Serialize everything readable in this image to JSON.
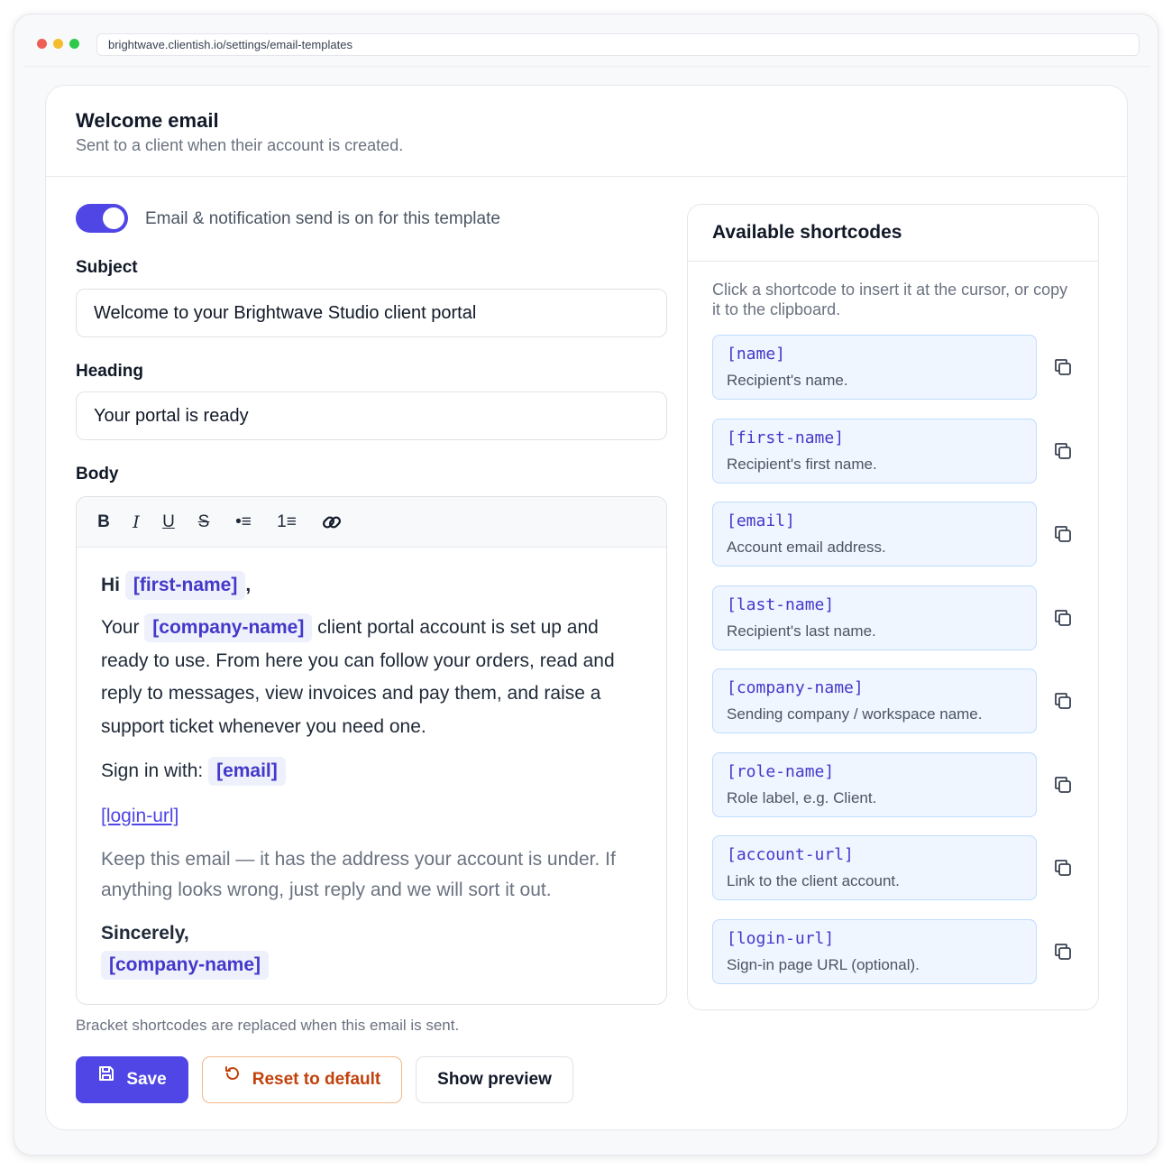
{
  "browser": {
    "url": "brightwave.clientish.io/settings/email-templates"
  },
  "template": {
    "title": "Welcome email",
    "subtitle": "Sent to a client when their account is created.",
    "toggle_label": "Email & notification send is on for this template",
    "toggle_on": true
  },
  "subject": {
    "label": "Subject",
    "value": "Welcome to your Brightwave Studio client portal"
  },
  "heading": {
    "label": "Heading",
    "value": "Your portal is ready"
  },
  "body": {
    "label": "Body",
    "toolbar": {
      "bold": "B",
      "italic": "I",
      "underline": "U",
      "strike": "S",
      "bullets": "•≡",
      "numbered": "1≡"
    },
    "greeting": "Hi",
    "greeting_code": "[first-name]",
    "greeting_comma": ",",
    "p1_start": "Your",
    "p1_code": "[company-name]",
    "p1_rest": "client portal account is set up and ready to use. From here you can follow your orders, read and reply to messages, view invoices and pay them, and raise a support ticket whenever you need one.",
    "signin_label": "Sign in with:",
    "signin_code": "[email]",
    "login_link": "[login-url]",
    "note": "Keep this email — it has the address your account is under. If anything looks wrong, just reply and we will sort it out.",
    "closing": "Sincerely,",
    "closing_code": "[company-name]"
  },
  "hint": "Bracket shortcodes are replaced when this email is sent.",
  "buttons": {
    "save": "Save",
    "reset": "Reset to default",
    "preview": "Show preview"
  },
  "shortcodes": {
    "title": "Available shortcodes",
    "description": "Click a shortcode to insert it at the cursor, or copy it to the clipboard.",
    "items": [
      {
        "code": "[name]",
        "desc": "Recipient's name."
      },
      {
        "code": "[first-name]",
        "desc": "Recipient's first name."
      },
      {
        "code": "[email]",
        "desc": "Account email address."
      },
      {
        "code": "[last-name]",
        "desc": "Recipient's last name."
      },
      {
        "code": "[company-name]",
        "desc": "Sending company / workspace name."
      },
      {
        "code": "[role-name]",
        "desc": "Role label, e.g. Client."
      },
      {
        "code": "[account-url]",
        "desc": "Link to the client account."
      },
      {
        "code": "[login-url]",
        "desc": "Sign-in page URL (optional)."
      }
    ]
  },
  "colors": {
    "accent": "#4f46e5",
    "chip_bg": "#eef0fb",
    "shortcode_bg": "#eff6ff",
    "reset": "#c2410c"
  },
  "icons": {
    "save": "floppy-disk-icon",
    "reset": "rotate-ccw-icon",
    "copy": "copy-icon",
    "link": "link-icon"
  }
}
